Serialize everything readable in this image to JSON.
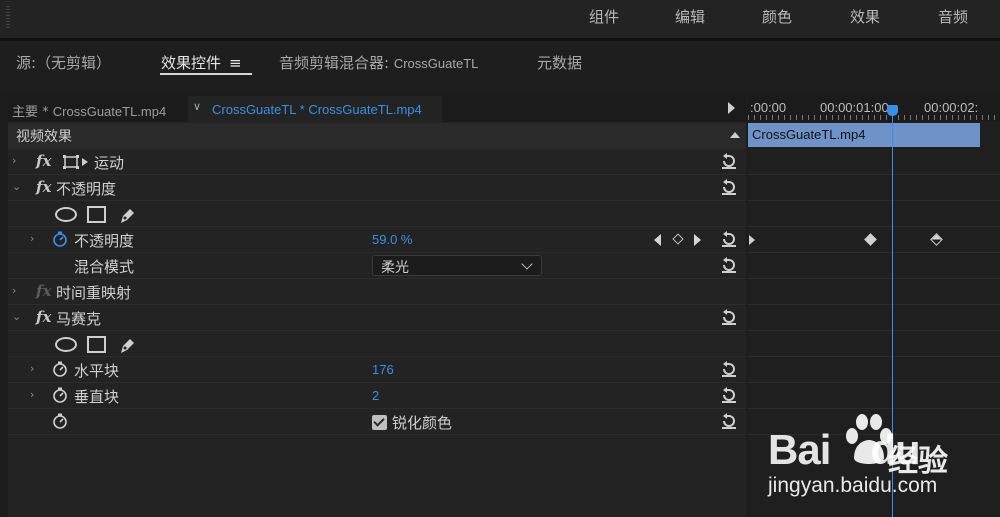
{
  "workspaces": [
    "组件",
    "编辑",
    "颜色",
    "效果",
    "音频"
  ],
  "panel_tabs": {
    "source": "源:（无剪辑）",
    "effect_controls": "效果控件",
    "audio_mixer_prefix": "音频剪辑混合器: ",
    "audio_mixer_clip": "CrossGuateTL",
    "metadata": "元数据"
  },
  "clip_tabs": {
    "master_prefix": "主要 * ",
    "master_clip": "CrossGuateTL.mp4",
    "sequence": "CrossGuateTL * CrossGuateTL.mp4"
  },
  "section_title": "视频效果",
  "effects": {
    "motion": "运动",
    "opacity": "不透明度",
    "opacity_param": "不透明度",
    "opacity_value": "59.0 %",
    "blend_mode_label": "混合模式",
    "blend_mode_value": "柔光",
    "time_remap": "时间重映射",
    "mosaic": "马赛克",
    "horizontal_blocks": "水平块",
    "horizontal_value": "176",
    "vertical_blocks": "垂直块",
    "vertical_value": "2",
    "sharpen_colors": "锐化颜色"
  },
  "timeline": {
    "times": [
      ":00:00",
      "00:00:01:00",
      "00:00:02:"
    ],
    "clip_name": "CrossGuateTL.mp4"
  },
  "watermark": {
    "brand": "Bai",
    "brand2": "du",
    "product": "经验",
    "url": "jingyan.baidu.com"
  },
  "colors": {
    "accent": "#3d8ee6",
    "clip": "#6f93c9"
  }
}
